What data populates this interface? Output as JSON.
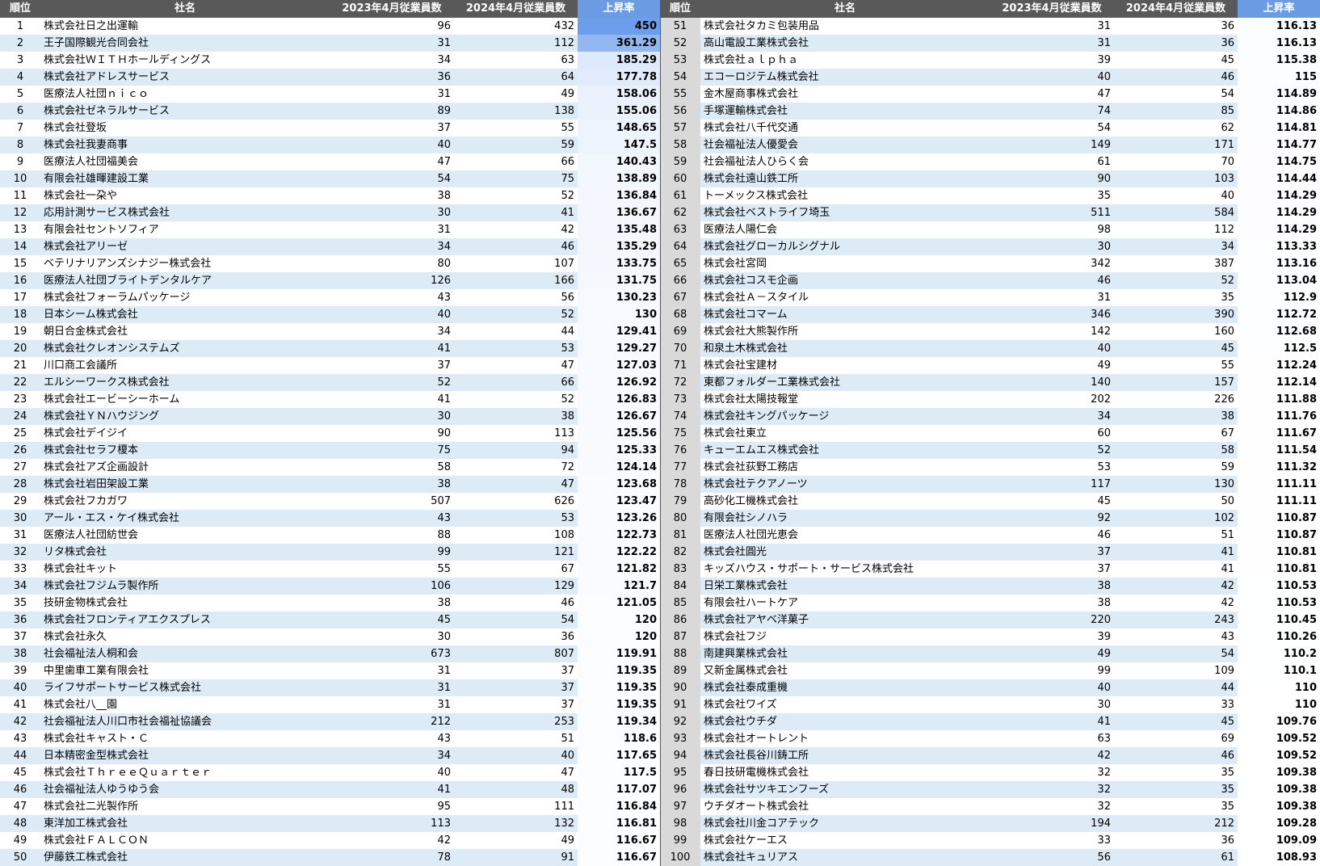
{
  "columns": {
    "rank": "順位",
    "name": "社名",
    "emp_2023": "2023年4月従業員数",
    "emp_2024": "2024年4月従業員数",
    "rate": "上昇率"
  },
  "colors": {
    "header_background": "#595959",
    "header_text": "#ffffff",
    "rate_header_background": "#6b9be3",
    "stripe_background": "#ddebf7",
    "right_rank_column_background": "#d9d9d9",
    "rate_scale_min": "#ffffff",
    "rate_scale_max": "#6d9eeb"
  },
  "rows": [
    {
      "rank": 1,
      "name": "株式会社日之出運輸",
      "emp_2023": 96,
      "emp_2024": 432,
      "rate": 450
    },
    {
      "rank": 2,
      "name": "王子国際観光合同会社",
      "emp_2023": 31,
      "emp_2024": 112,
      "rate": 361.29
    },
    {
      "rank": 3,
      "name": "株式会社ＷＩＴＨホールディングス",
      "emp_2023": 34,
      "emp_2024": 63,
      "rate": 185.29
    },
    {
      "rank": 4,
      "name": "株式会社アドレスサービス",
      "emp_2023": 36,
      "emp_2024": 64,
      "rate": 177.78
    },
    {
      "rank": 5,
      "name": "医療法人社団ｎｉｃｏ",
      "emp_2023": 31,
      "emp_2024": 49,
      "rate": 158.06
    },
    {
      "rank": 6,
      "name": "株式会社ゼネラルサービス",
      "emp_2023": 89,
      "emp_2024": 138,
      "rate": 155.06
    },
    {
      "rank": 7,
      "name": "株式会社登坂",
      "emp_2023": 37,
      "emp_2024": 55,
      "rate": 148.65
    },
    {
      "rank": 8,
      "name": "株式会社我妻商事",
      "emp_2023": 40,
      "emp_2024": 59,
      "rate": 147.5
    },
    {
      "rank": 9,
      "name": "医療法人社団福美会",
      "emp_2023": 47,
      "emp_2024": 66,
      "rate": 140.43
    },
    {
      "rank": 10,
      "name": "有限会社雄暉建設工業",
      "emp_2023": 54,
      "emp_2024": 75,
      "rate": 138.89
    },
    {
      "rank": 11,
      "name": "株式会社一朶や",
      "emp_2023": 38,
      "emp_2024": 52,
      "rate": 136.84
    },
    {
      "rank": 12,
      "name": "応用計測サービス株式会社",
      "emp_2023": 30,
      "emp_2024": 41,
      "rate": 136.67
    },
    {
      "rank": 13,
      "name": "有限会社セントソフィア",
      "emp_2023": 31,
      "emp_2024": 42,
      "rate": 135.48
    },
    {
      "rank": 14,
      "name": "株式会社アリーゼ",
      "emp_2023": 34,
      "emp_2024": 46,
      "rate": 135.29
    },
    {
      "rank": 15,
      "name": "ベテリナリアンズシナジー株式会社",
      "emp_2023": 80,
      "emp_2024": 107,
      "rate": 133.75
    },
    {
      "rank": 16,
      "name": "医療法人社団ブライトデンタルケア",
      "emp_2023": 126,
      "emp_2024": 166,
      "rate": 131.75
    },
    {
      "rank": 17,
      "name": "株式会社フォーラムパッケージ",
      "emp_2023": 43,
      "emp_2024": 56,
      "rate": 130.23
    },
    {
      "rank": 18,
      "name": "日本シーム株式会社",
      "emp_2023": 40,
      "emp_2024": 52,
      "rate": 130
    },
    {
      "rank": 19,
      "name": "朝日合金株式会社",
      "emp_2023": 34,
      "emp_2024": 44,
      "rate": 129.41
    },
    {
      "rank": 20,
      "name": "株式会社クレオンシステムズ",
      "emp_2023": 41,
      "emp_2024": 53,
      "rate": 129.27
    },
    {
      "rank": 21,
      "name": "川口商工会議所",
      "emp_2023": 37,
      "emp_2024": 47,
      "rate": 127.03
    },
    {
      "rank": 22,
      "name": "エルシーワークス株式会社",
      "emp_2023": 52,
      "emp_2024": 66,
      "rate": 126.92
    },
    {
      "rank": 23,
      "name": "株式会社エービーシーホーム",
      "emp_2023": 41,
      "emp_2024": 52,
      "rate": 126.83
    },
    {
      "rank": 24,
      "name": "株式会社ＹＮハウジング",
      "emp_2023": 30,
      "emp_2024": 38,
      "rate": 126.67
    },
    {
      "rank": 25,
      "name": "株式会社デイジイ",
      "emp_2023": 90,
      "emp_2024": 113,
      "rate": 125.56
    },
    {
      "rank": 26,
      "name": "株式会社セラフ榎本",
      "emp_2023": 75,
      "emp_2024": 94,
      "rate": 125.33
    },
    {
      "rank": 27,
      "name": "株式会社アズ企画設計",
      "emp_2023": 58,
      "emp_2024": 72,
      "rate": 124.14
    },
    {
      "rank": 28,
      "name": "株式会社岩田架設工業",
      "emp_2023": 38,
      "emp_2024": 47,
      "rate": 123.68
    },
    {
      "rank": 29,
      "name": "株式会社フカガワ",
      "emp_2023": 507,
      "emp_2024": 626,
      "rate": 123.47
    },
    {
      "rank": 30,
      "name": "アール・エス・ケイ株式会社",
      "emp_2023": 43,
      "emp_2024": 53,
      "rate": 123.26
    },
    {
      "rank": 31,
      "name": "医療法人社団紡世会",
      "emp_2023": 88,
      "emp_2024": 108,
      "rate": 122.73
    },
    {
      "rank": 32,
      "name": "リタ株式会社",
      "emp_2023": 99,
      "emp_2024": 121,
      "rate": 122.22
    },
    {
      "rank": 33,
      "name": "株式会社キット",
      "emp_2023": 55,
      "emp_2024": 67,
      "rate": 121.82
    },
    {
      "rank": 34,
      "name": "株式会社フジムラ製作所",
      "emp_2023": 106,
      "emp_2024": 129,
      "rate": 121.7
    },
    {
      "rank": 35,
      "name": "技研金物株式会社",
      "emp_2023": 38,
      "emp_2024": 46,
      "rate": 121.05
    },
    {
      "rank": 36,
      "name": "株式会社フロンティアエクスプレス",
      "emp_2023": 45,
      "emp_2024": 54,
      "rate": 120
    },
    {
      "rank": 37,
      "name": "株式会社永久",
      "emp_2023": 30,
      "emp_2024": 36,
      "rate": 120
    },
    {
      "rank": 38,
      "name": "社会福祉法人桐和会",
      "emp_2023": 673,
      "emp_2024": 807,
      "rate": 119.91
    },
    {
      "rank": 39,
      "name": "中里歯車工業有限会社",
      "emp_2023": 31,
      "emp_2024": 37,
      "rate": 119.35
    },
    {
      "rank": 40,
      "name": "ライフサポートサービス株式会社",
      "emp_2023": 31,
      "emp_2024": 37,
      "rate": 119.35
    },
    {
      "rank": 41,
      "name": "株式会社八__園",
      "emp_2023": 31,
      "emp_2024": 37,
      "rate": 119.35
    },
    {
      "rank": 42,
      "name": "社会福祉法人川口市社会福祉協議会",
      "emp_2023": 212,
      "emp_2024": 253,
      "rate": 119.34
    },
    {
      "rank": 43,
      "name": "株式会社キャスト・Ｃ",
      "emp_2023": 43,
      "emp_2024": 51,
      "rate": 118.6
    },
    {
      "rank": 44,
      "name": "日本精密金型株式会社",
      "emp_2023": 34,
      "emp_2024": 40,
      "rate": 117.65
    },
    {
      "rank": 45,
      "name": "株式会社ＴｈｒｅｅＱｕａｒｔｅｒ",
      "emp_2023": 40,
      "emp_2024": 47,
      "rate": 117.5
    },
    {
      "rank": 46,
      "name": "社会福祉法人ゆうゆう会",
      "emp_2023": 41,
      "emp_2024": 48,
      "rate": 117.07
    },
    {
      "rank": 47,
      "name": "株式会社二光製作所",
      "emp_2023": 95,
      "emp_2024": 111,
      "rate": 116.84
    },
    {
      "rank": 48,
      "name": "東洋加工株式会社",
      "emp_2023": 113,
      "emp_2024": 132,
      "rate": 116.81
    },
    {
      "rank": 49,
      "name": "株式会社ＦＡＬＣＯＮ",
      "emp_2023": 42,
      "emp_2024": 49,
      "rate": 116.67
    },
    {
      "rank": 50,
      "name": "伊藤鉄工株式会社",
      "emp_2023": 78,
      "emp_2024": 91,
      "rate": 116.67
    },
    {
      "rank": 51,
      "name": "株式会社タカミ包装用品",
      "emp_2023": 31,
      "emp_2024": 36,
      "rate": 116.13
    },
    {
      "rank": 52,
      "name": "高山電設工業株式会社",
      "emp_2023": 31,
      "emp_2024": 36,
      "rate": 116.13
    },
    {
      "rank": 53,
      "name": "株式会社ａｌｐｈａ",
      "emp_2023": 39,
      "emp_2024": 45,
      "rate": 115.38
    },
    {
      "rank": 54,
      "name": "エコーロジテム株式会社",
      "emp_2023": 40,
      "emp_2024": 46,
      "rate": 115
    },
    {
      "rank": 55,
      "name": "金木屋商事株式会社",
      "emp_2023": 47,
      "emp_2024": 54,
      "rate": 114.89
    },
    {
      "rank": 56,
      "name": "手塚運輸株式会社",
      "emp_2023": 74,
      "emp_2024": 85,
      "rate": 114.86
    },
    {
      "rank": 57,
      "name": "株式会社八千代交通",
      "emp_2023": 54,
      "emp_2024": 62,
      "rate": 114.81
    },
    {
      "rank": 58,
      "name": "社会福祉法人優愛会",
      "emp_2023": 149,
      "emp_2024": 171,
      "rate": 114.77
    },
    {
      "rank": 59,
      "name": "社会福祉法人ひらく会",
      "emp_2023": 61,
      "emp_2024": 70,
      "rate": 114.75
    },
    {
      "rank": 60,
      "name": "株式会社遠山鉄工所",
      "emp_2023": 90,
      "emp_2024": 103,
      "rate": 114.44
    },
    {
      "rank": 61,
      "name": "トーメックス株式会社",
      "emp_2023": 35,
      "emp_2024": 40,
      "rate": 114.29
    },
    {
      "rank": 62,
      "name": "株式会社ベストライフ埼玉",
      "emp_2023": 511,
      "emp_2024": 584,
      "rate": 114.29
    },
    {
      "rank": 63,
      "name": "医療法人陽仁会",
      "emp_2023": 98,
      "emp_2024": 112,
      "rate": 114.29
    },
    {
      "rank": 64,
      "name": "株式会社グローカルシグナル",
      "emp_2023": 30,
      "emp_2024": 34,
      "rate": 113.33
    },
    {
      "rank": 65,
      "name": "株式会社宮岡",
      "emp_2023": 342,
      "emp_2024": 387,
      "rate": 113.16
    },
    {
      "rank": 66,
      "name": "株式会社コスモ企画",
      "emp_2023": 46,
      "emp_2024": 52,
      "rate": 113.04
    },
    {
      "rank": 67,
      "name": "株式会社Ａ－スタイル",
      "emp_2023": 31,
      "emp_2024": 35,
      "rate": 112.9
    },
    {
      "rank": 68,
      "name": "株式会社コマーム",
      "emp_2023": 346,
      "emp_2024": 390,
      "rate": 112.72
    },
    {
      "rank": 69,
      "name": "株式会社大熊製作所",
      "emp_2023": 142,
      "emp_2024": 160,
      "rate": 112.68
    },
    {
      "rank": 70,
      "name": "和泉土木株式会社",
      "emp_2023": 40,
      "emp_2024": 45,
      "rate": 112.5
    },
    {
      "rank": 71,
      "name": "株式会社宝建材",
      "emp_2023": 49,
      "emp_2024": 55,
      "rate": 112.24
    },
    {
      "rank": 72,
      "name": "東都フォルダー工業株式会社",
      "emp_2023": 140,
      "emp_2024": 157,
      "rate": 112.14
    },
    {
      "rank": 73,
      "name": "株式会社太陽技報堂",
      "emp_2023": 202,
      "emp_2024": 226,
      "rate": 111.88
    },
    {
      "rank": 74,
      "name": "株式会社キングパッケージ",
      "emp_2023": 34,
      "emp_2024": 38,
      "rate": 111.76
    },
    {
      "rank": 75,
      "name": "株式会社東立",
      "emp_2023": 60,
      "emp_2024": 67,
      "rate": 111.67
    },
    {
      "rank": 76,
      "name": "キューエムエス株式会社",
      "emp_2023": 52,
      "emp_2024": 58,
      "rate": 111.54
    },
    {
      "rank": 77,
      "name": "株式会社荻野工務店",
      "emp_2023": 53,
      "emp_2024": 59,
      "rate": 111.32
    },
    {
      "rank": 78,
      "name": "株式会社テクアノーツ",
      "emp_2023": 117,
      "emp_2024": 130,
      "rate": 111.11
    },
    {
      "rank": 79,
      "name": "高砂化工機株式会社",
      "emp_2023": 45,
      "emp_2024": 50,
      "rate": 111.11
    },
    {
      "rank": 80,
      "name": "有限会社シノハラ",
      "emp_2023": 92,
      "emp_2024": 102,
      "rate": 110.87
    },
    {
      "rank": 81,
      "name": "医療法人社団光恵会",
      "emp_2023": 46,
      "emp_2024": 51,
      "rate": 110.87
    },
    {
      "rank": 82,
      "name": "株式会社圓光",
      "emp_2023": 37,
      "emp_2024": 41,
      "rate": 110.81
    },
    {
      "rank": 83,
      "name": "キッズハウス・サポート・サービス株式会社",
      "emp_2023": 37,
      "emp_2024": 41,
      "rate": 110.81
    },
    {
      "rank": 84,
      "name": "日栄工業株式会社",
      "emp_2023": 38,
      "emp_2024": 42,
      "rate": 110.53
    },
    {
      "rank": 85,
      "name": "有限会社ハートケア",
      "emp_2023": 38,
      "emp_2024": 42,
      "rate": 110.53
    },
    {
      "rank": 86,
      "name": "株式会社アヤベ洋菓子",
      "emp_2023": 220,
      "emp_2024": 243,
      "rate": 110.45
    },
    {
      "rank": 87,
      "name": "株式会社フジ",
      "emp_2023": 39,
      "emp_2024": 43,
      "rate": 110.26
    },
    {
      "rank": 88,
      "name": "南建興業株式会社",
      "emp_2023": 49,
      "emp_2024": 54,
      "rate": 110.2
    },
    {
      "rank": 89,
      "name": "又新金属株式会社",
      "emp_2023": 99,
      "emp_2024": 109,
      "rate": 110.1
    },
    {
      "rank": 90,
      "name": "株式会社泰成重機",
      "emp_2023": 40,
      "emp_2024": 44,
      "rate": 110
    },
    {
      "rank": 91,
      "name": "株式会社ワイズ",
      "emp_2023": 30,
      "emp_2024": 33,
      "rate": 110
    },
    {
      "rank": 92,
      "name": "株式会社ウチダ",
      "emp_2023": 41,
      "emp_2024": 45,
      "rate": 109.76
    },
    {
      "rank": 93,
      "name": "株式会社オートレント",
      "emp_2023": 63,
      "emp_2024": 69,
      "rate": 109.52
    },
    {
      "rank": 94,
      "name": "株式会社長谷川鋳工所",
      "emp_2023": 42,
      "emp_2024": 46,
      "rate": 109.52
    },
    {
      "rank": 95,
      "name": "春日技研電機株式会社",
      "emp_2023": 32,
      "emp_2024": 35,
      "rate": 109.38
    },
    {
      "rank": 96,
      "name": "株式会社サツキエンフーズ",
      "emp_2023": 32,
      "emp_2024": 35,
      "rate": 109.38
    },
    {
      "rank": 97,
      "name": "ウチダオート株式会社",
      "emp_2023": 32,
      "emp_2024": 35,
      "rate": 109.38
    },
    {
      "rank": 98,
      "name": "株式会社川金コアテック",
      "emp_2023": 194,
      "emp_2024": 212,
      "rate": 109.28
    },
    {
      "rank": 99,
      "name": "株式会社ケーエス",
      "emp_2023": 33,
      "emp_2024": 36,
      "rate": 109.09
    },
    {
      "rank": 100,
      "name": "株式会社キュリアス",
      "emp_2023": 56,
      "emp_2024": 61,
      "rate": 108.93
    }
  ]
}
